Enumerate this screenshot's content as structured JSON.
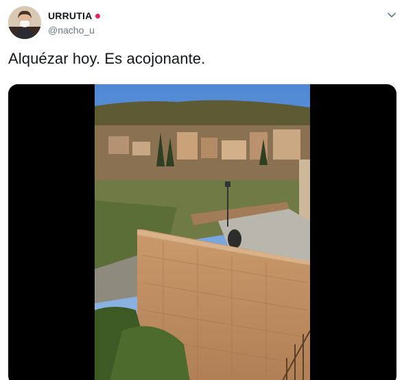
{
  "author": {
    "display_name": "URRUTIA",
    "handle": "@nacho_u",
    "badge_icon": "rose-icon",
    "badge_color": "#e0245e"
  },
  "tweet": {
    "text": "Alquézar hoy. Es acojonante."
  },
  "menu": {
    "icon": "chevron-down-icon"
  },
  "media": {
    "type": "video",
    "description_icon": "video-thumbnail"
  },
  "colors": {
    "text_primary": "#14171a",
    "text_secondary": "#657786",
    "media_background": "#000000"
  }
}
